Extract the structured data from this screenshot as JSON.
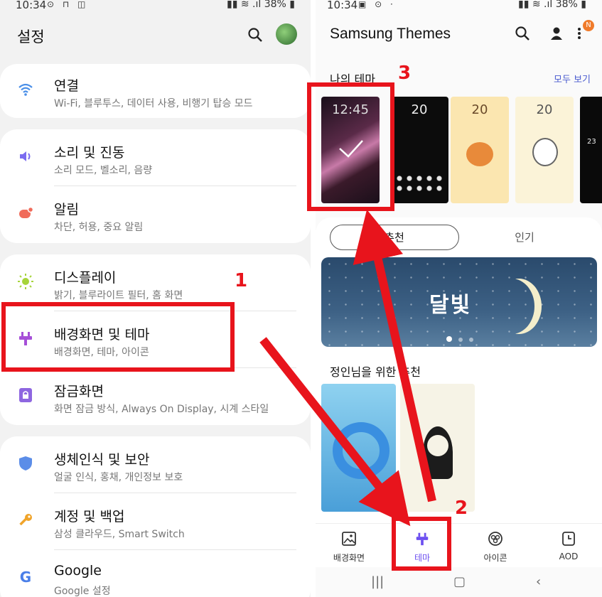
{
  "left": {
    "status": {
      "time": "10:34",
      "battery": "38%"
    },
    "title": "설정",
    "rows": [
      {
        "title": "연결",
        "subtitle": "Wi-Fi, 블루투스, 데이터 사용, 비행기 탑승 모드",
        "icon": "wifi-icon",
        "color": "#4a8fe8"
      },
      {
        "title": "소리 및 진동",
        "subtitle": "소리 모드, 벨소리, 음량",
        "icon": "speaker-icon",
        "color": "#7b6cf0"
      },
      {
        "title": "알림",
        "subtitle": "차단, 허용, 중요 알림",
        "icon": "notification-icon",
        "color": "#f06b5a"
      },
      {
        "title": "디스플레이",
        "subtitle": "밝기, 블루라이트 필터, 홈 화면",
        "icon": "brightness-icon",
        "color": "#a6d43a"
      },
      {
        "title": "배경화면 및 테마",
        "subtitle": "배경화면, 테마, 아이콘",
        "icon": "theme-brush-icon",
        "color": "#a64fd8"
      },
      {
        "title": "잠금화면",
        "subtitle": "화면 잠금 방식, Always On Display, 시계 스타일",
        "icon": "lock-icon",
        "color": "#8e66e0"
      },
      {
        "title": "생체인식 및 보안",
        "subtitle": "얼굴 인식, 홍채, 개인정보 보호",
        "icon": "shield-icon",
        "color": "#5b8de8"
      },
      {
        "title": "계정 및 백업",
        "subtitle": "삼성 클라우드, Smart Switch",
        "icon": "key-icon",
        "color": "#f0a42a"
      },
      {
        "title": "Google",
        "subtitle": "Google 설정",
        "icon": "google-icon",
        "color": "#4a7fe8"
      }
    ]
  },
  "right": {
    "status": {
      "time": "10:34",
      "battery": "38%"
    },
    "title": "Samsung Themes",
    "badge": "N",
    "my_themes": "나의 테마",
    "view_all": "모두 보기",
    "clock_main": "12:45",
    "thumb_clock": "20",
    "thumb_clock_last": "23",
    "tabs": {
      "recommended": "추천",
      "popular": "인기"
    },
    "banner_text": "달빛",
    "for_you": "정인님을 위한 추천",
    "nav": {
      "wallpaper": "배경화면",
      "theme": "테마",
      "icons": "아이콘",
      "aod": "AOD"
    },
    "accent": "#6c4ff0"
  },
  "annotations": {
    "step1": "1",
    "step2": "2",
    "step3": "3",
    "color": "#e8141c"
  }
}
